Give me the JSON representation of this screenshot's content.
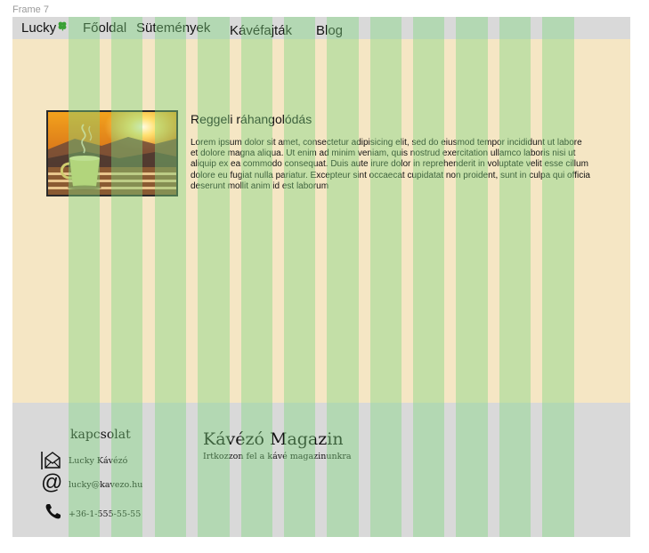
{
  "frame": {
    "label": "Frame 7"
  },
  "nav": {
    "brand": "Lucky",
    "brand_icon": "four-leaf-clover-icon",
    "items": [
      "Főoldal",
      "Sütemények",
      "Kávéfajták",
      "Blog"
    ]
  },
  "article": {
    "title": "Reggeli ráhangolódás",
    "body": "Lorem ipsum dolor sit amet, consectetur adipisicing elit, sed do eiusmod tempor incididunt ut labore et dolore magna aliqua. Ut enim ad minim veniam, quis nostrud exercitation ullamco laboris nisi ut aliquip ex ea commodo consequat. Duis aute irure dolor in reprehenderit in voluptate velit esse cillum dolore eu fugiat nulla pariatur. Excepteur sint occaecat cupidatat non proident, sunt in culpa qui officia deserunt mollit anim id est laborum",
    "image": "coffee-cup-at-sunrise-photo"
  },
  "footer": {
    "contact_title": "kapcsolat",
    "contacts": [
      {
        "icon": "mail-icon",
        "text": "Lucky Kávézó"
      },
      {
        "icon": "at-sign-icon",
        "text": "lucky@kavezo.hu"
      },
      {
        "icon": "phone-icon",
        "text": "+36-1-555-55-55"
      }
    ],
    "magazine_title": "Kávézó Magazin",
    "magazine_subtitle": "Irtkozzon fel a kávé magazinunkra"
  },
  "colors": {
    "page_background": "#f5e6c4",
    "bar_gray": "#d9d9d9",
    "grid_column": "rgba(126,214,126,0.42)",
    "clover_green": "#3aa035"
  }
}
